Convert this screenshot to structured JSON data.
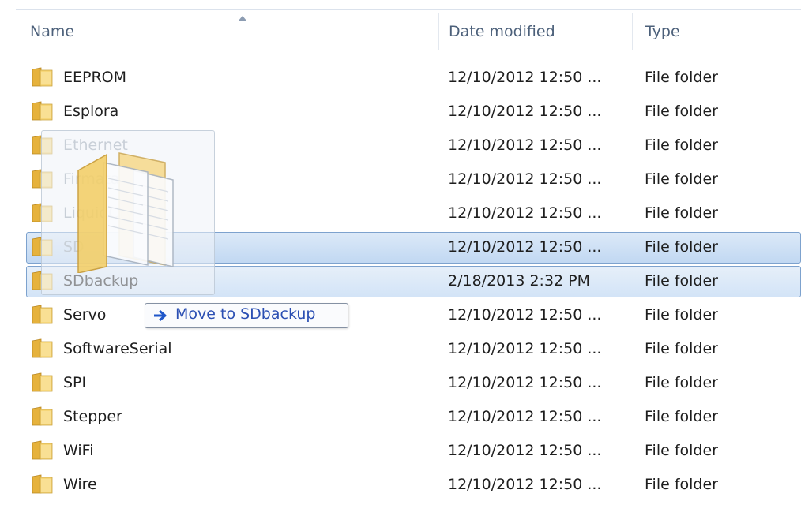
{
  "columns": {
    "name": "Name",
    "date_modified": "Date modified",
    "type": "Type"
  },
  "rows": [
    {
      "name": "EEPROM",
      "date": "12/10/2012 12:50 ...",
      "type": "File folder"
    },
    {
      "name": "Esplora",
      "date": "12/10/2012 12:50 ...",
      "type": "File folder"
    },
    {
      "name": "Ethernet",
      "date": "12/10/2012 12:50 ...",
      "type": "File folder"
    },
    {
      "name": "Firmata",
      "date": "12/10/2012 12:50 ...",
      "type": "File folder"
    },
    {
      "name": "LiquidCrystal",
      "date": "12/10/2012 12:50 ...",
      "type": "File folder"
    },
    {
      "name": "SD",
      "date": "12/10/2012 12:50 ...",
      "type": "File folder"
    },
    {
      "name": "SDbackup",
      "date": "2/18/2013 2:32 PM",
      "type": "File folder"
    },
    {
      "name": "Servo",
      "date": "12/10/2012 12:50 ...",
      "type": "File folder"
    },
    {
      "name": "SoftwareSerial",
      "date": "12/10/2012 12:50 ...",
      "type": "File folder"
    },
    {
      "name": "SPI",
      "date": "12/10/2012 12:50 ...",
      "type": "File folder"
    },
    {
      "name": "Stepper",
      "date": "12/10/2012 12:50 ...",
      "type": "File folder"
    },
    {
      "name": "WiFi",
      "date": "12/10/2012 12:50 ...",
      "type": "File folder"
    },
    {
      "name": "Wire",
      "date": "12/10/2012 12:50 ...",
      "type": "File folder"
    }
  ],
  "selected_row": "SD",
  "drop_target_row": "SDbackup",
  "drag_tooltip": {
    "icon": "right-arrow-icon",
    "text": "Move to SDbackup"
  },
  "icons": {
    "folder": "folder-icon",
    "sort": "sort-ascending-icon"
  },
  "colors": {
    "selection_border": "#7da2ce",
    "selection_fill": "#cfe1f5",
    "tooltip_text": "#2b4fb3",
    "folder_yellow": "#f2c94c"
  }
}
